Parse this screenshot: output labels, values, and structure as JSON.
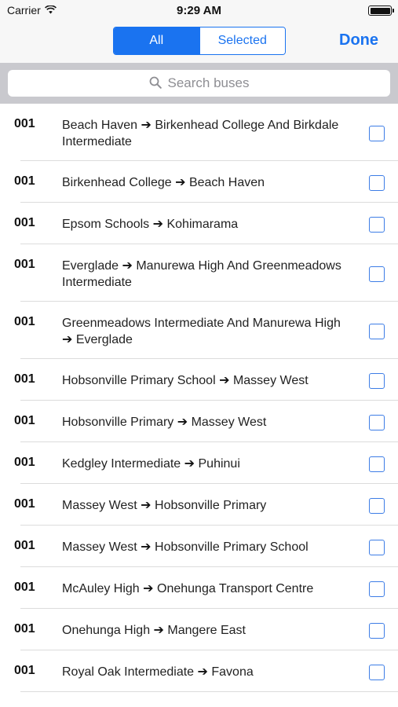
{
  "status_bar": {
    "carrier": "Carrier",
    "time": "9:29 AM"
  },
  "nav": {
    "segments": [
      "All",
      "Selected"
    ],
    "done_label": "Done"
  },
  "search": {
    "placeholder": "Search buses"
  },
  "routes": [
    {
      "number": "001",
      "from": "Beach Haven",
      "to": "Birkenhead College And Birkdale Intermediate",
      "checked": false
    },
    {
      "number": "001",
      "from": "Birkenhead College",
      "to": "Beach Haven",
      "checked": false
    },
    {
      "number": "001",
      "from": "Epsom Schools",
      "to": "Kohimarama",
      "checked": false
    },
    {
      "number": "001",
      "from": "Everglade",
      "to": "Manurewa High And Greenmeadows Intermediate",
      "checked": false
    },
    {
      "number": "001",
      "from": "Greenmeadows Intermediate And Manurewa High",
      "to": "Everglade",
      "checked": false
    },
    {
      "number": "001",
      "from": "Hobsonville Primary School",
      "to": "Massey West",
      "checked": false
    },
    {
      "number": "001",
      "from": "Hobsonville Primary",
      "to": "Massey West",
      "checked": false
    },
    {
      "number": "001",
      "from": "Kedgley Intermediate",
      "to": "Puhinui",
      "checked": false
    },
    {
      "number": "001",
      "from": "Massey West",
      "to": "Hobsonville Primary",
      "checked": false
    },
    {
      "number": "001",
      "from": "Massey West",
      "to": "Hobsonville Primary School",
      "checked": false
    },
    {
      "number": "001",
      "from": "McAuley High",
      "to": "Onehunga Transport Centre",
      "checked": false
    },
    {
      "number": "001",
      "from": "Onehunga High",
      "to": "Mangere East",
      "checked": false
    },
    {
      "number": "001",
      "from": "Royal Oak Intermediate",
      "to": "Favona",
      "checked": false
    }
  ],
  "colors": {
    "accent": "#1a73f0",
    "checkbox": "#3d7de6",
    "search_bar_bg": "#c9c9ce"
  },
  "icons": {
    "route_arrow": "arrow-right-icon",
    "search": "search-icon",
    "wifi": "wifi-icon"
  }
}
